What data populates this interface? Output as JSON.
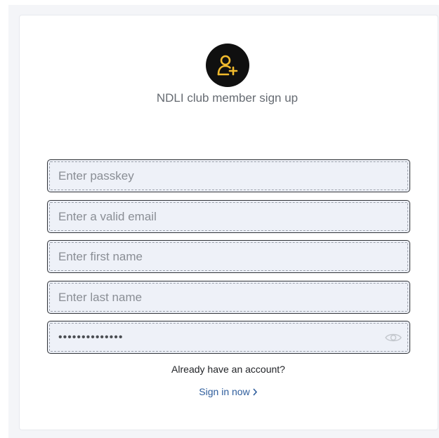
{
  "header": {
    "icon": "user-add-icon",
    "title": "NDLI club member sign up"
  },
  "form": {
    "passkey_placeholder": "Enter passkey",
    "email_placeholder": "Enter a valid email",
    "first_name_placeholder": "Enter first name",
    "last_name_placeholder": "Enter last name",
    "password_value": "••••••••••••••",
    "password_toggle_icon": "eye-icon"
  },
  "footer": {
    "prompt": "Already have an account?",
    "signin_label": "Sign in now"
  },
  "colors": {
    "accent_icon": "#f2bb2d",
    "link": "#2e5d9c",
    "field_bg": "#eef1f8"
  }
}
